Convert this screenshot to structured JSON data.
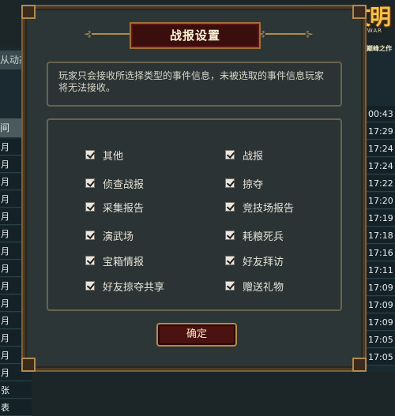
{
  "background": {
    "left_header": "从动态",
    "left_header2": "间",
    "left_rows": [
      "月",
      "月",
      "月",
      "月",
      "月",
      "月",
      "月",
      "月",
      "月",
      "月",
      "月",
      "月",
      "月",
      "月",
      "张",
      "表"
    ],
    "right_rows": [
      "00:43",
      "17:29",
      "17:24",
      "17:24",
      "17:22",
      "17:20",
      "17:19",
      "17:18",
      "17:16",
      "17:11",
      "17:09",
      "17:09",
      "17:09",
      "17:05",
      "17:05"
    ]
  },
  "logo": {
    "title": "帝国文明",
    "subtitle": "MINISTRY OF WAR",
    "tagline": "第二代网页游戏巅峰之作"
  },
  "dialog": {
    "title": "战报设置",
    "description": "玩家只会接收所选择类型的事件信息，未被选取的事件信息玩家将无法接收。",
    "options_left": [
      {
        "label": "其他",
        "checked": true
      },
      {
        "label": "侦查战报",
        "checked": true
      },
      {
        "label": "采集报告",
        "checked": true
      },
      {
        "label": "演武场",
        "checked": true
      },
      {
        "label": "宝箱情报",
        "checked": true
      },
      {
        "label": "好友掠夺共享",
        "checked": true
      }
    ],
    "options_right": [
      {
        "label": "战报",
        "checked": true
      },
      {
        "label": "掠夺",
        "checked": true
      },
      {
        "label": "竞技场报告",
        "checked": true
      },
      {
        "label": "耗粮死兵",
        "checked": true
      },
      {
        "label": "好友拜访",
        "checked": true
      },
      {
        "label": "赠送礼物",
        "checked": true
      }
    ],
    "confirm_label": "确定"
  }
}
